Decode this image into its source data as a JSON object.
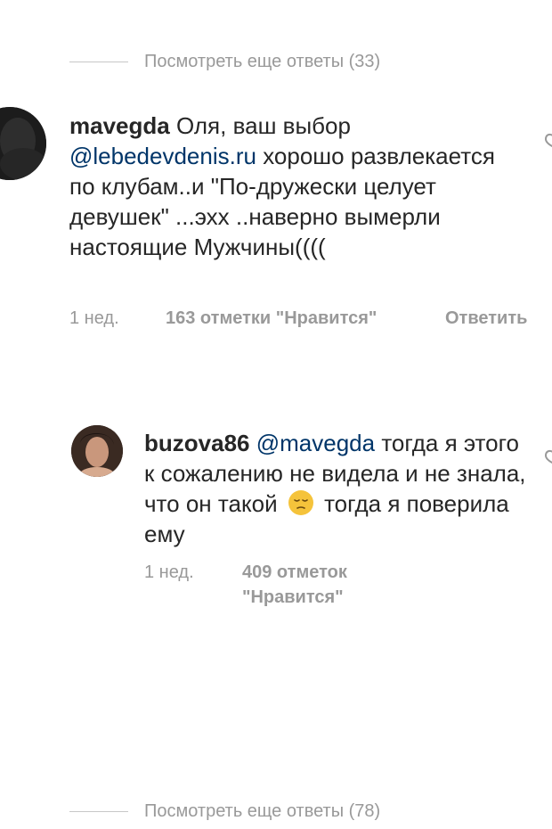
{
  "view_more_top": {
    "label": "Посмотреть еще ответы (33)"
  },
  "view_more_bottom": {
    "label": "Посмотреть еще ответы (78)"
  },
  "comment": {
    "username": "mavegda",
    "text_before": " Оля, ваш выбор ",
    "mention": "@lebedevdenis.ru",
    "text_after": " хорошо развлекается по клубам..и \"По-дружески целует девушек\" ...эхх ..наверно вымерли настоящие Мужчины((((",
    "time": "1 нед.",
    "likes": "163 отметки \"Нравится\"",
    "reply": "Ответить"
  },
  "reply": {
    "username": "buzova86",
    "mention": "@mavegda",
    "text_before": " тогда я этого к сожалению не видела и не знала, что он такой ",
    "emoji": "pensive-face-emoji",
    "text_after": " тогда я поверила ему",
    "time": "1 нед.",
    "likes": "409 отметок \"Нравится\""
  },
  "colors": {
    "text": "#262626",
    "muted": "#999999",
    "mention": "#003569",
    "divider": "#c7c7c7"
  }
}
